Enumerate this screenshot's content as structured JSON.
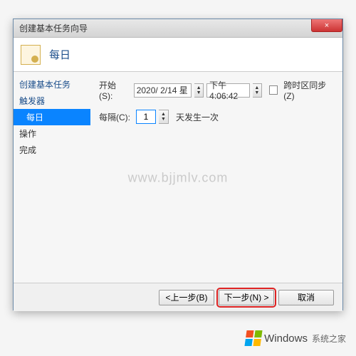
{
  "window": {
    "title": "创建基本任务向导",
    "close": "×"
  },
  "header": {
    "title": "每日"
  },
  "sidebar": {
    "items": [
      {
        "label": "创建基本任务",
        "indent": false,
        "selected": false
      },
      {
        "label": "触发器",
        "indent": false,
        "selected": false
      },
      {
        "label": "每日",
        "indent": true,
        "selected": true
      },
      {
        "label": "操作",
        "indent": false,
        "selected": false
      },
      {
        "label": "完成",
        "indent": false,
        "selected": false
      }
    ]
  },
  "content": {
    "start_label": "开始(S):",
    "date_value": "2020/ 2/14 星",
    "time_value": "下午  4:06:42",
    "sync_label": "跨时区同步(Z)",
    "interval_label": "每隔(C):",
    "interval_value": "1",
    "interval_suffix": "天发生一次"
  },
  "footer": {
    "back": "<上一步(B)",
    "next": "下一步(N) >",
    "cancel": "取消"
  },
  "watermark": "www.bjjmlv.com",
  "brand": {
    "name": "Windows",
    "sub": "系统之家"
  }
}
